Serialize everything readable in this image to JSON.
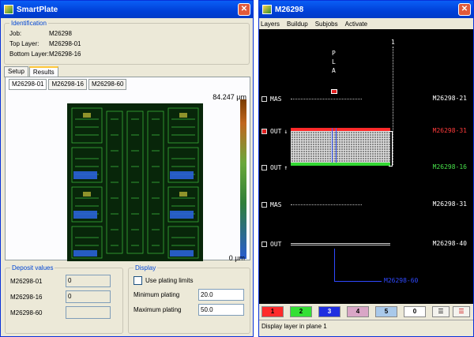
{
  "left_window": {
    "title": "SmartPlate",
    "identification": {
      "legend": "Identification",
      "job_label": "Job:",
      "job_value": "M26298",
      "top_layer_label": "Top Layer:",
      "top_layer_value": "M26298-01",
      "bottom_layer_label": "Bottom Layer:",
      "bottom_layer_value": "M26298-16"
    },
    "tabs": [
      "Setup",
      "Results"
    ],
    "active_tab": "Results",
    "sub_tabs": [
      "M26298-01",
      "M26298-16",
      "M26298-60"
    ],
    "scale_max": "84.247 µm",
    "scale_min": "0 µm",
    "deposit": {
      "legend": "Deposit values",
      "rows": [
        {
          "label": "M26298-01",
          "value": "0"
        },
        {
          "label": "M26298-16",
          "value": "0"
        },
        {
          "label": "M26298-60",
          "value": ""
        }
      ]
    },
    "display": {
      "legend": "Display",
      "use_limits_label": "Use plating limits",
      "min_label": "Minimum plating",
      "min_value": "20.0",
      "max_label": "Maximum plating",
      "max_value": "50.0"
    }
  },
  "right_window": {
    "title": "M26298",
    "menu": [
      "Layers",
      "Buildup",
      "Subjobs",
      "Activate"
    ],
    "pla_letters": [
      "P",
      "L",
      "A"
    ],
    "marker_top": "1",
    "layers": [
      {
        "name": "MAS",
        "id": "M26298-21",
        "color": "#ffffff"
      },
      {
        "name": "OUT",
        "arrow": "↓",
        "id": "M26298-31",
        "color": "#ff3b3b"
      },
      {
        "name": "OUT",
        "arrow": "↑",
        "id": "M26298-16",
        "color": "#47e04a"
      },
      {
        "name": "MAS",
        "id": "M26298-31",
        "color": "#ffffff"
      },
      {
        "name": "OUT",
        "id": "M26298-40",
        "color": "#ffffff"
      }
    ],
    "bottom_label": "M26298-60",
    "bottom_label_color": "#2f49ff",
    "toolbar_buttons": [
      {
        "label": "1",
        "color": "#ff2b2b"
      },
      {
        "label": "2",
        "color": "#34e034"
      },
      {
        "label": "3",
        "color": "#1f2fe0"
      },
      {
        "label": "4",
        "color": "#d9a6c6"
      },
      {
        "label": "5",
        "color": "#a9c9ea"
      },
      {
        "label": "0",
        "color": "#ffffff"
      }
    ],
    "status": "Display layer in plane 1"
  }
}
